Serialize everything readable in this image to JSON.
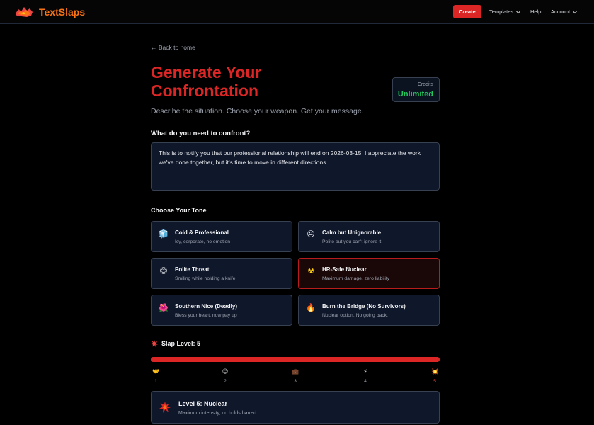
{
  "nav": {
    "brand": "TextSlaps",
    "create_label": "Create",
    "templates_label": "Templates",
    "help_label": "Help",
    "account_label": "Account"
  },
  "page": {
    "back_label": "← Back to home",
    "title": "Generate Your Confrontation",
    "subtitle": "Describe the situation. Choose your weapon. Get your message.",
    "credits_label": "Credits",
    "credits_value": "Unlimited"
  },
  "situation": {
    "label": "What do you need to confront?",
    "value": "This is to notify you that our professional relationship will end on 2026-03-15. I appreciate the work we've done together, but it's time to move in different directions."
  },
  "tones": {
    "label": "Choose Your Tone",
    "items": [
      {
        "name": "Cold & Professional",
        "desc": "Icy, corporate, no emotion",
        "emoji": "🧊",
        "icon": "ice-cube-icon"
      },
      {
        "name": "Calm but Unignorable",
        "desc": "Polite but you can't ignore it",
        "emoji": "😐",
        "icon": "neutral-face-icon"
      },
      {
        "name": "Polite Threat",
        "desc": "Smiling while holding a knife",
        "emoji": "😊",
        "icon": "smiling-face-icon"
      },
      {
        "name": "HR-Safe Nuclear",
        "desc": "Maximum damage, zero liability",
        "emoji": "☢",
        "icon": "radioactive-icon"
      },
      {
        "name": "Southern Nice (Deadly)",
        "desc": "Bless your heart, now pay up",
        "emoji": "🌺",
        "icon": "flower-icon"
      },
      {
        "name": "Burn the Bridge (No Survivors)",
        "desc": "Nuclear option. No going back.",
        "emoji": "🔥",
        "icon": "fire-icon"
      }
    ],
    "selected_index": 3
  },
  "slap": {
    "label": "Slap Level: 5",
    "level": 5,
    "max": 5,
    "ticks": [
      {
        "num": "1",
        "emoji": "🤝",
        "icon": "handshake-icon"
      },
      {
        "num": "2",
        "emoji": "😐",
        "icon": "neutral-face-icon"
      },
      {
        "num": "3",
        "emoji": "💼",
        "icon": "briefcase-icon"
      },
      {
        "num": "4",
        "emoji": "⚡",
        "icon": "lightning-icon"
      },
      {
        "num": "5",
        "emoji": "💥",
        "icon": "explosion-icon"
      }
    ],
    "level_title": "Level 5: Nuclear",
    "level_desc": "Maximum intensity, no holds barred"
  },
  "colors": {
    "accent": "#dc2626",
    "brand": "#f97316",
    "credits": "#22c55e",
    "card_bg": "#0f172a"
  }
}
